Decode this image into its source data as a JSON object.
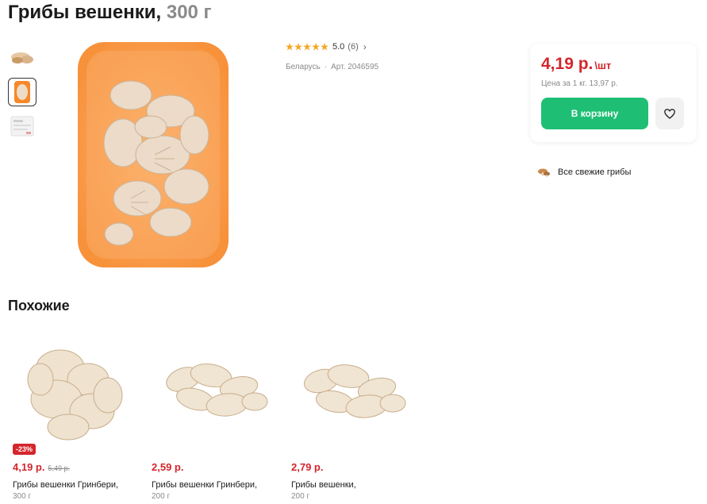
{
  "product": {
    "title": "Грибы вешенки,",
    "weight": "300 г",
    "rating_value": "5.0",
    "rating_count": "(6)",
    "country": "Беларусь",
    "article": "Арт. 2046595"
  },
  "price_card": {
    "price": "4,19 р.",
    "unit": "\\шт",
    "unit_price": "Цена за 1 кг. 13,97 р.",
    "cart_label": "В корзину"
  },
  "category": {
    "label": "Все свежие грибы"
  },
  "similar": {
    "title": "Похожие",
    "items": [
      {
        "badge": "-23%",
        "price": "4,19 р.",
        "old_price": "5,49 р.",
        "name": "Грибы вешенки Гринбери,",
        "weight": "300 г"
      },
      {
        "price": "2,59 р.",
        "name": "Грибы вешенки Гринбери,",
        "weight": "200 г"
      },
      {
        "price": "2,79 р.",
        "name": "Грибы вешенки,",
        "weight": "200 г"
      }
    ]
  },
  "colors": {
    "accent_red": "#d4262c",
    "cart_green": "#1ebf75",
    "star_orange": "#f5a623",
    "tray_orange": "#f7882a"
  }
}
